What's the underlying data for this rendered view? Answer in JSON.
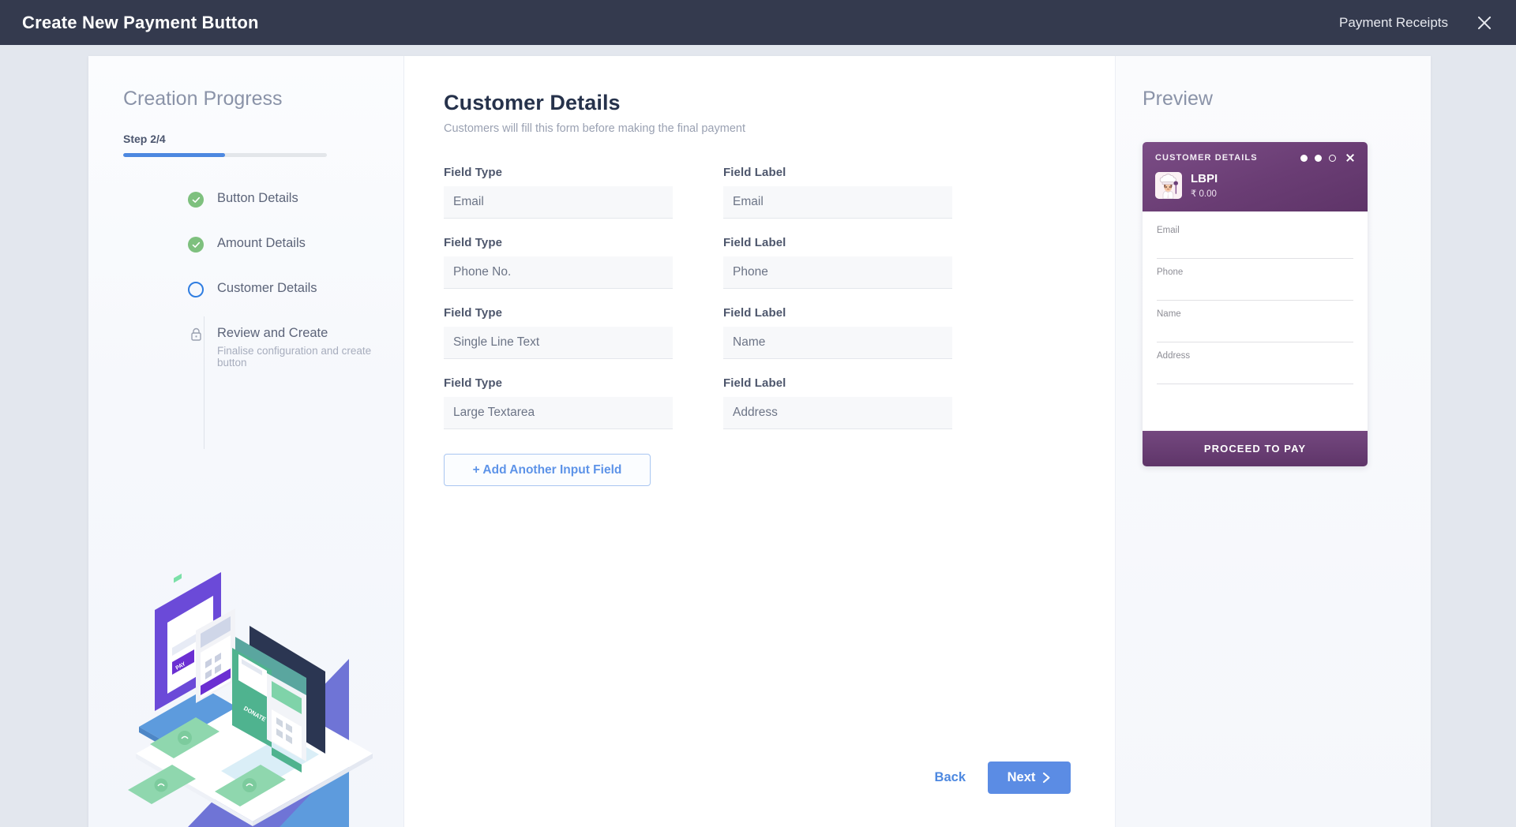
{
  "topbar": {
    "title": "Create New Payment Button",
    "link_label": "Payment Receipts",
    "close_icon": "close-icon"
  },
  "sidebar": {
    "title": "Creation Progress",
    "step_counter": "Step 2/4",
    "progress_percent": 50,
    "steps": [
      {
        "label": "Button Details",
        "state": "done",
        "sub": ""
      },
      {
        "label": "Amount Details",
        "state": "done",
        "sub": ""
      },
      {
        "label": "Customer Details",
        "state": "current",
        "sub": ""
      },
      {
        "label": "Review and Create",
        "state": "locked",
        "sub": "Finalise configuration and create button"
      }
    ],
    "illustration": "payment-buttons-isometric-illustration"
  },
  "main": {
    "title": "Customer Details",
    "subtitle": "Customers will fill this form before making the final payment",
    "type_label": "Field Type",
    "label_label": "Field Label",
    "fields": [
      {
        "type": "Email",
        "label": "Email"
      },
      {
        "type": "Phone No.",
        "label": "Phone"
      },
      {
        "type": "Single Line Text",
        "label": "Name"
      },
      {
        "type": "Large Textarea",
        "label": "Address"
      }
    ],
    "add_field_label": "+ Add Another Input Field",
    "back_label": "Back",
    "next_label": "Next"
  },
  "preview": {
    "title": "Preview",
    "card": {
      "header_title": "CUSTOMER DETAILS",
      "merchant_name": "LBPI",
      "merchant_amount": "₹ 0.00",
      "avatar_icon": "chef-avatar-icon",
      "fields": [
        "Email",
        "Phone",
        "Name",
        "Address"
      ],
      "cta_label": "PROCEED TO PAY"
    }
  },
  "colors": {
    "topbar_bg": "#343a4e",
    "accent_blue": "#5b8ce4",
    "progress_blue": "#4d88e0",
    "done_green": "#7ec07e",
    "card_purple": "#6a3d74",
    "page_bg": "#e3e7ee"
  }
}
